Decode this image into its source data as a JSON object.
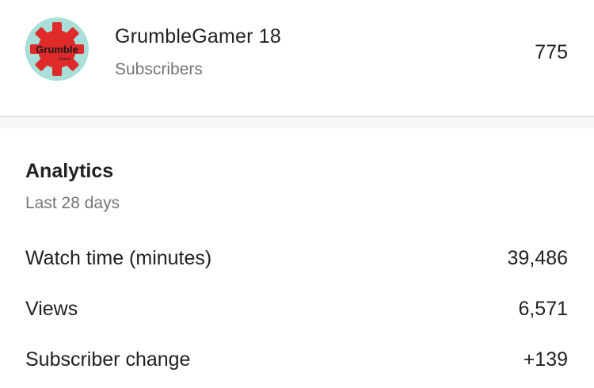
{
  "channel": {
    "avatar_icon": "grumble-gear-logo-icon",
    "avatar_text": "Grumble",
    "avatar_subtext": "Gamer",
    "name": "GrumbleGamer 18",
    "subscribers_label": "Subscribers",
    "subscriber_count": "775"
  },
  "analytics": {
    "title": "Analytics",
    "period": "Last 28 days",
    "metrics": [
      {
        "label": "Watch time (minutes)",
        "value": "39,486"
      },
      {
        "label": "Views",
        "value": "6,571"
      },
      {
        "label": "Subscriber change",
        "value": "+139"
      }
    ]
  },
  "colors": {
    "avatar_background": "#a9dfd9",
    "gear_red": "#e02a2a",
    "secondary_text": "#757575",
    "primary_text": "#212121"
  }
}
